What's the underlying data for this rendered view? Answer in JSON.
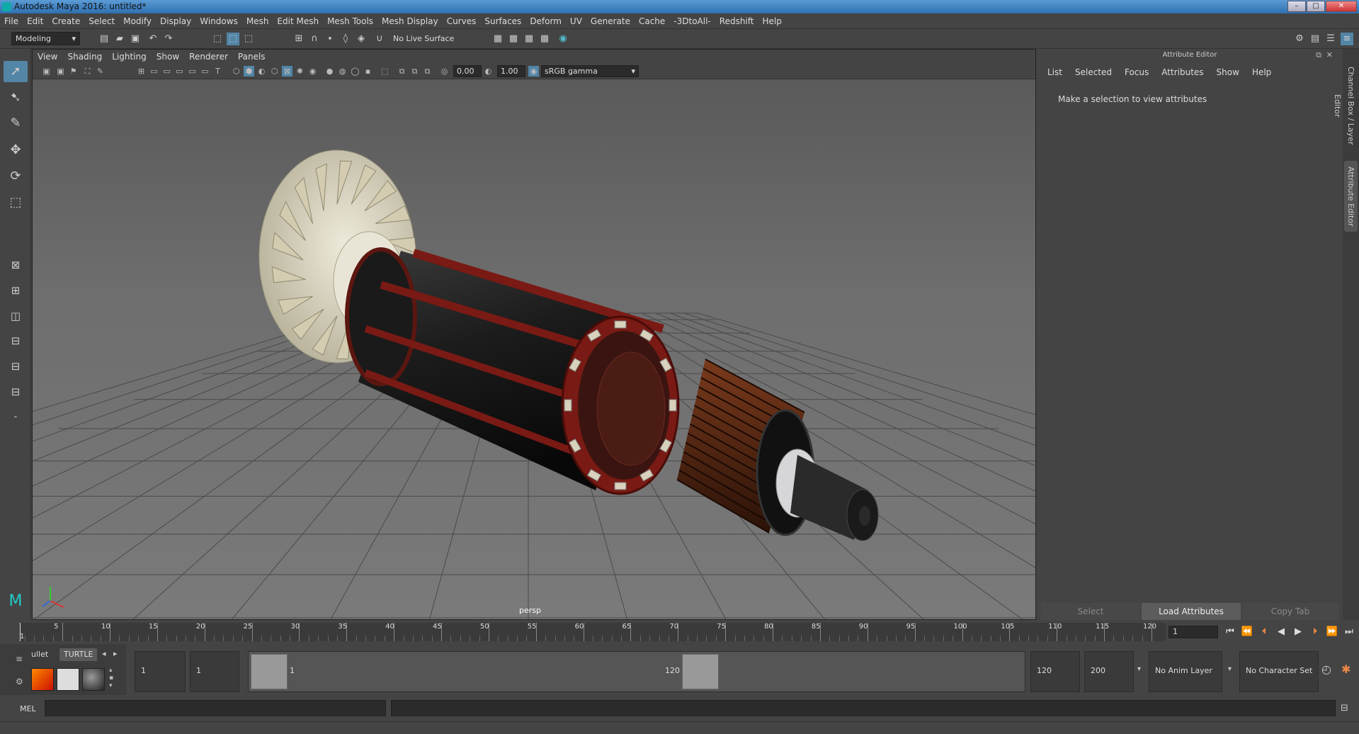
{
  "window": {
    "title": "Autodesk Maya 2016: untitled*"
  },
  "menu": [
    "File",
    "Edit",
    "Create",
    "Select",
    "Modify",
    "Display",
    "Windows",
    "Mesh",
    "Edit Mesh",
    "Mesh Tools",
    "Mesh Display",
    "Curves",
    "Surfaces",
    "Deform",
    "UV",
    "Generate",
    "Cache",
    "-3DtoAll-",
    "Redshift",
    "Help"
  ],
  "statusline": {
    "menu_set": "Modeling",
    "live_surface": "No Live Surface"
  },
  "panel": {
    "menu": [
      "View",
      "Shading",
      "Lighting",
      "Show",
      "Renderer",
      "Panels"
    ],
    "exposure": "0.00",
    "gamma": "1.00",
    "color_space": "sRGB gamma",
    "camera": "persp"
  },
  "attribute_editor": {
    "title": "Attribute Editor",
    "menu": [
      "List",
      "Selected",
      "Focus",
      "Attributes",
      "Show",
      "Help"
    ],
    "message": "Make a selection to view attributes",
    "buttons": {
      "select": "Select",
      "load": "Load Attributes",
      "copy": "Copy Tab"
    }
  },
  "side_tabs": {
    "channel_box": "Channel Box / Layer Editor",
    "attribute_editor": "Attribute Editor"
  },
  "timeline": {
    "ticks": [
      "5",
      "10",
      "15",
      "20",
      "25",
      "30",
      "35",
      "40",
      "45",
      "50",
      "55",
      "60",
      "65",
      "70",
      "75",
      "80",
      "85",
      "90",
      "95",
      "100",
      "105",
      "110",
      "115",
      "120"
    ],
    "start_label": "1",
    "current_frame": "1"
  },
  "range": {
    "shelf_tabs": [
      "ullet",
      "TURTLE"
    ],
    "start": "1",
    "playback_start": "1",
    "slider_start": "1",
    "slider_end": "120",
    "playback_end": "120",
    "end": "200",
    "anim_layer": "No Anim Layer",
    "character_set": "No Character Set"
  },
  "command": {
    "mode": "MEL"
  },
  "colors": {
    "accent": "#5285a6",
    "rotor_red": "#7a1a14",
    "fan": "#d8d2b8",
    "copper": "#5a2a14"
  }
}
